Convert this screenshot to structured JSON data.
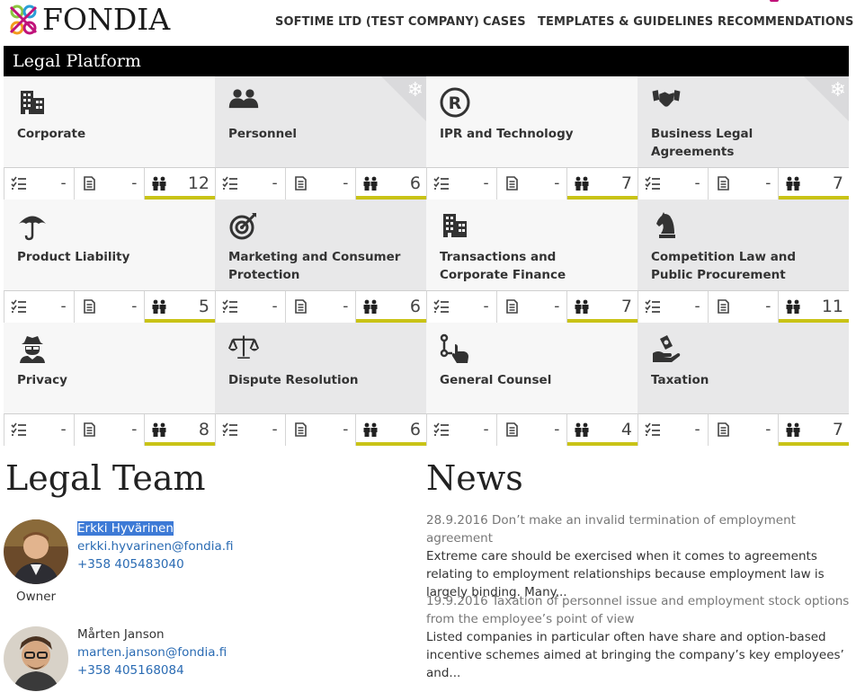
{
  "brand": {
    "name": "FONDIA",
    "accent": "#c9c316",
    "logo_colors": [
      "#c0137a",
      "#2a9fd6",
      "#8cc63f",
      "#f29b1d"
    ]
  },
  "nav": {
    "items": [
      {
        "label": "SOFTIME LTD (TEST COMPANY)"
      },
      {
        "label": "CASES"
      },
      {
        "label": "TEMPLATES & GUIDELINES"
      },
      {
        "label": "RECOMMENDATIONS"
      }
    ]
  },
  "banner": {
    "title": "Legal Platform"
  },
  "tiles": [
    {
      "title": "Corporate",
      "icon": "building-icon",
      "tasks": "-",
      "docs": "-",
      "people": "12",
      "corner": false
    },
    {
      "title": "Personnel",
      "icon": "people-icon",
      "tasks": "-",
      "docs": "-",
      "people": "6",
      "corner": true
    },
    {
      "title": "IPR and Technology",
      "icon": "registered-icon",
      "tasks": "-",
      "docs": "-",
      "people": "7",
      "corner": false
    },
    {
      "title": "Business Legal Agreements",
      "icon": "handshake-icon",
      "tasks": "-",
      "docs": "-",
      "people": "7",
      "corner": true
    },
    {
      "title": "Product Liability",
      "icon": "umbrella-icon",
      "tasks": "-",
      "docs": "-",
      "people": "5",
      "corner": false
    },
    {
      "title": "Marketing and Consumer Protection",
      "icon": "target-icon",
      "tasks": "-",
      "docs": "-",
      "people": "6",
      "corner": false
    },
    {
      "title": "Transactions and Corporate Finance",
      "icon": "building-icon",
      "tasks": "-",
      "docs": "-",
      "people": "7",
      "corner": false
    },
    {
      "title": "Competition Law and Public Procurement",
      "icon": "chess-knight-icon",
      "tasks": "-",
      "docs": "-",
      "people": "11",
      "corner": false
    },
    {
      "title": "Privacy",
      "icon": "spy-icon",
      "tasks": "-",
      "docs": "-",
      "people": "8",
      "corner": false
    },
    {
      "title": "Dispute Resolution",
      "icon": "scales-icon",
      "tasks": "-",
      "docs": "-",
      "people": "6",
      "corner": false
    },
    {
      "title": "General Counsel",
      "icon": "route-hand-icon",
      "tasks": "-",
      "docs": "-",
      "people": "4",
      "corner": false
    },
    {
      "title": "Taxation",
      "icon": "money-hand-icon",
      "tasks": "-",
      "docs": "-",
      "people": "7",
      "corner": false
    }
  ],
  "team": {
    "title": "Legal Team",
    "members": [
      {
        "name": "Erkki Hyvärinen",
        "email": "erkki.hyvarinen@fondia.fi",
        "phone": "+358 405483040",
        "role": "Owner"
      },
      {
        "name": "Mårten Janson",
        "email": "marten.janson@fondia.fi",
        "phone": "+358 405168084"
      }
    ]
  },
  "news": {
    "title": "News",
    "items": [
      {
        "headline": "28.9.2016 Don’t make an invalid termination of employment agreement",
        "body": "Extreme care should be exercised when it comes to agreements relating to employment relationships because employment law is largely binding. Many..."
      },
      {
        "headline": "19.9.2016 Taxation of personnel issue and employment stock options from the employee’s point of view",
        "body": "Listed companies in particular often have share and option-based incentive schemes aimed at bringing the company’s key employees’ and..."
      }
    ]
  }
}
